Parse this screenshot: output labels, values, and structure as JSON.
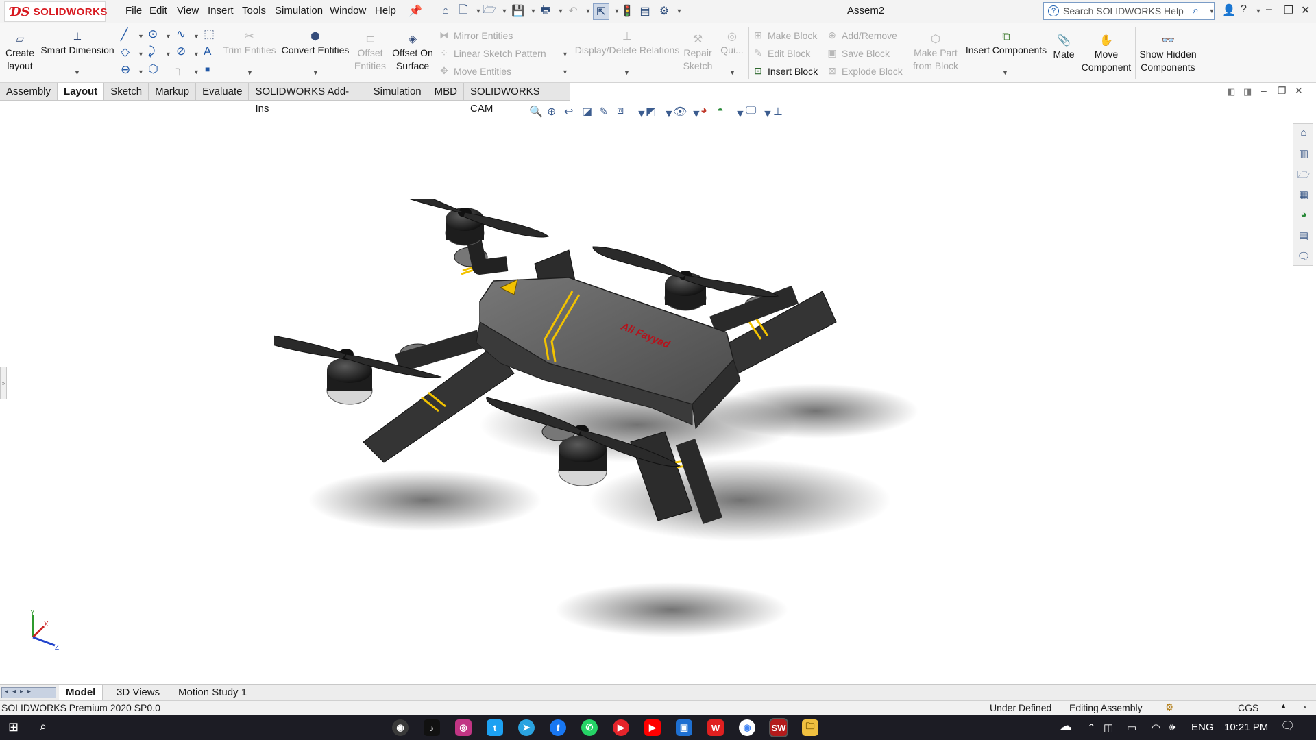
{
  "app": {
    "logo_text": "SOLIDWORKS",
    "document_title": "Assem2",
    "search_placeholder": "Search SOLIDWORKS Help"
  },
  "menu": [
    "File",
    "Edit",
    "View",
    "Insert",
    "Tools",
    "Simulation",
    "Window",
    "Help"
  ],
  "commands": {
    "create_layout": [
      "Create",
      "layout"
    ],
    "smart_dimension": "Smart Dimension",
    "trim_entities": "Trim Entities",
    "convert_entities": "Convert Entities",
    "offset_entities": [
      "Offset",
      "Entities"
    ],
    "offset_on_surface": [
      "Offset On",
      "Surface"
    ],
    "mirror_entities": "Mirror Entities",
    "linear_sketch_pattern": "Linear Sketch Pattern",
    "move_entities": "Move Entities",
    "display_delete_relations": "Display/Delete Relations",
    "repair_sketch": [
      "Repair",
      "Sketch"
    ],
    "quick_snaps": "Qui...",
    "make_block": "Make Block",
    "edit_block": "Edit Block",
    "insert_block": "Insert Block",
    "add_remove": "Add/Remove",
    "save_block": "Save Block",
    "explode_block": "Explode Block",
    "make_part_from_block": [
      "Make Part",
      "from Block"
    ],
    "insert_components": "Insert Components",
    "mate": "Mate",
    "move_component": [
      "Move",
      "Component"
    ],
    "show_hidden_components": [
      "Show Hidden",
      "Components"
    ]
  },
  "tabs": [
    "Assembly",
    "Layout",
    "Sketch",
    "Markup",
    "Evaluate",
    "SOLIDWORKS Add-Ins",
    "Simulation",
    "MBD",
    "SOLIDWORKS CAM"
  ],
  "active_tab": "Layout",
  "model": {
    "label_text": "Ali Fayyad"
  },
  "triad": {
    "x": "X",
    "y": "Y",
    "z": "Z"
  },
  "bottom_tabs": [
    "Model",
    "3D Views",
    "Motion Study 1"
  ],
  "status": {
    "left": "SOLIDWORKS Premium 2020 SP0.0",
    "state": "Under Defined",
    "mode": "Editing Assembly",
    "units": "CGS"
  },
  "taskbar": {
    "language": "ENG",
    "time": "10:21 PM"
  },
  "colors": {
    "accent_red": "#d71920",
    "drone_body": "#5a5a5a",
    "stripe": "#f2c200"
  }
}
